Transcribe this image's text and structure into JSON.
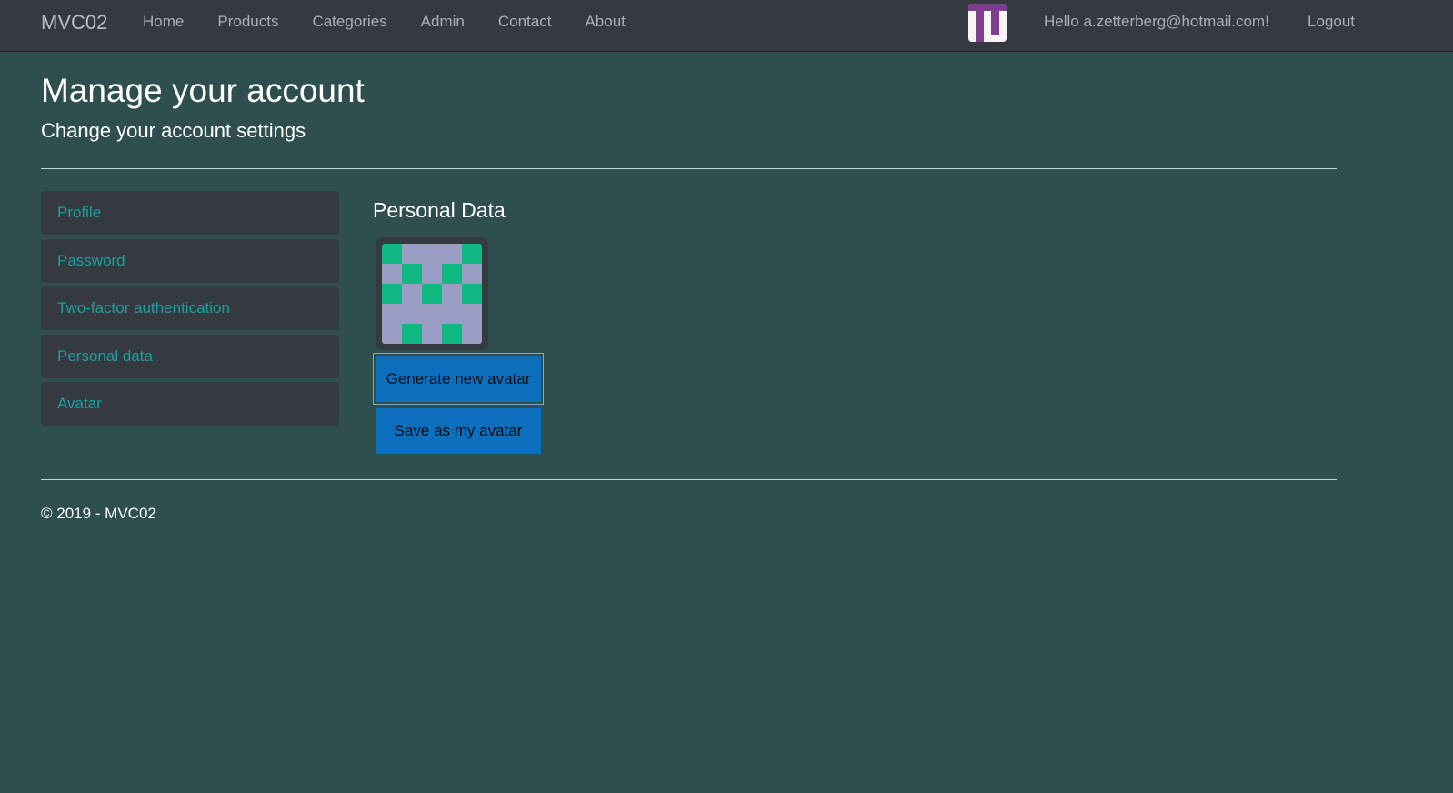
{
  "navbar": {
    "brand": "MVC02",
    "links": [
      "Home",
      "Products",
      "Categories",
      "Admin",
      "Contact",
      "About"
    ],
    "greeting": "Hello a.zetterberg@hotmail.com!",
    "logout": "Logout",
    "avatar_icon": "user-avatar-icon",
    "avatar_pattern": [
      [
        1,
        1,
        1,
        1,
        1
      ],
      [
        0,
        1,
        0,
        1,
        0
      ],
      [
        0,
        1,
        0,
        1,
        0
      ],
      [
        0,
        1,
        0,
        1,
        0
      ],
      [
        0,
        1,
        0,
        0,
        0
      ]
    ],
    "avatar_colors": {
      "on": "#7b3f8e",
      "off": "#f7f3f8"
    }
  },
  "header": {
    "title": "Manage your account",
    "subtitle": "Change your account settings"
  },
  "sidebar": {
    "items": [
      {
        "label": "Profile"
      },
      {
        "label": "Password"
      },
      {
        "label": "Two-factor authentication"
      },
      {
        "label": "Personal data"
      },
      {
        "label": "Avatar"
      }
    ]
  },
  "main": {
    "section_title": "Personal Data",
    "avatar_pattern": [
      [
        1,
        0,
        0,
        0,
        1
      ],
      [
        0,
        1,
        0,
        1,
        0
      ],
      [
        1,
        0,
        1,
        0,
        1
      ],
      [
        0,
        0,
        0,
        0,
        0
      ],
      [
        0,
        1,
        0,
        1,
        0
      ]
    ],
    "avatar_colors": {
      "on": "#10b981",
      "off": "#9b9ec4"
    },
    "generate_button": "Generate new avatar",
    "save_button": "Save as my avatar"
  },
  "footer": {
    "text": "© 2019 - MVC02"
  },
  "colors": {
    "background": "#2f4f4f",
    "navbar": "#343a40",
    "sidebar_link": "#17a2a2",
    "button": "#0b6fbd"
  }
}
